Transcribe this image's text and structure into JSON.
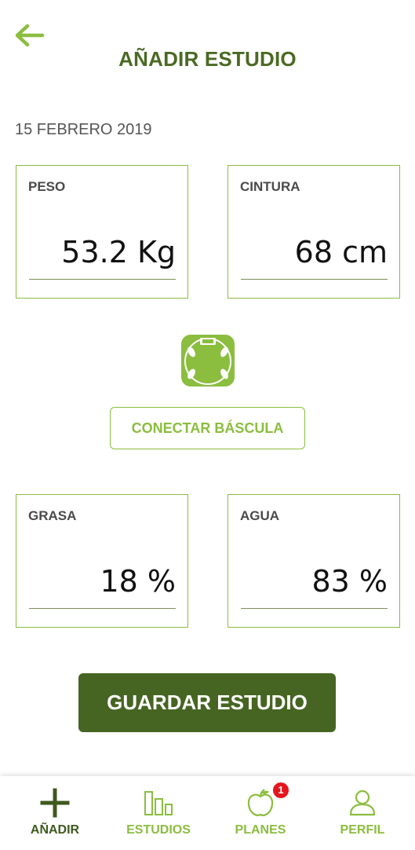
{
  "header": {
    "title": "AÑADIR ESTUDIO",
    "back_icon": "arrow-left-icon"
  },
  "study": {
    "date": "15 FEBRERO 2019"
  },
  "fields": {
    "peso": {
      "label": "PESO",
      "value": "53.2 Kg"
    },
    "cintura": {
      "label": "CINTURA",
      "value": "68 cm"
    },
    "grasa": {
      "label": "GRASA",
      "value": "18 %"
    },
    "agua": {
      "label": "AGUA",
      "value": "83 %"
    }
  },
  "scale": {
    "icon": "bathroom-scale-icon",
    "connect_label": "CONECTAR BÁSCULA"
  },
  "actions": {
    "save_label": "GUARDAR ESTUDIO"
  },
  "nav": {
    "items": [
      {
        "label": "AÑADIR",
        "icon": "plus-icon",
        "active": true
      },
      {
        "label": "ESTUDIOS",
        "icon": "bar-chart-icon",
        "active": false
      },
      {
        "label": "PLANES",
        "icon": "apple-icon",
        "active": false,
        "badge": "1"
      },
      {
        "label": "PERFIL",
        "icon": "user-icon",
        "active": false
      }
    ]
  },
  "colors": {
    "primary": "#466522",
    "accent": "#8bbd3f",
    "title": "#4a6a23",
    "badge": "#e5151d"
  }
}
